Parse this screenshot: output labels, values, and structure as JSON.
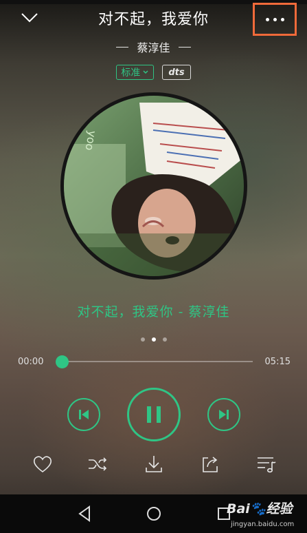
{
  "header": {
    "title": "对不起，我爱你",
    "artist": "蔡淳佳",
    "quality_label": "标准",
    "format_label": "dts"
  },
  "icons": {
    "collapse": "chevron-down-icon",
    "more": "more-dots-icon",
    "like": "heart-icon",
    "shuffle": "shuffle-icon",
    "download": "download-icon",
    "share": "share-icon",
    "playlist": "playlist-icon",
    "prev": "skip-previous-icon",
    "pause": "pause-icon",
    "next": "skip-next-icon",
    "nav_back": "nav-back-icon",
    "nav_home": "nav-home-icon",
    "nav_recent": "nav-recent-icon"
  },
  "now_playing": {
    "song_line": "对不起，我爱你 - 蔡淳佳",
    "page_count": 3,
    "active_page": 2
  },
  "progress": {
    "elapsed": "00:00",
    "total": "05:15",
    "fraction": 0.0
  },
  "watermark": {
    "main": "Bai🐾经验",
    "sub": "jingyan.baidu.com"
  },
  "colors": {
    "accent": "#2fc585",
    "highlight_box": "#f06a3a"
  }
}
